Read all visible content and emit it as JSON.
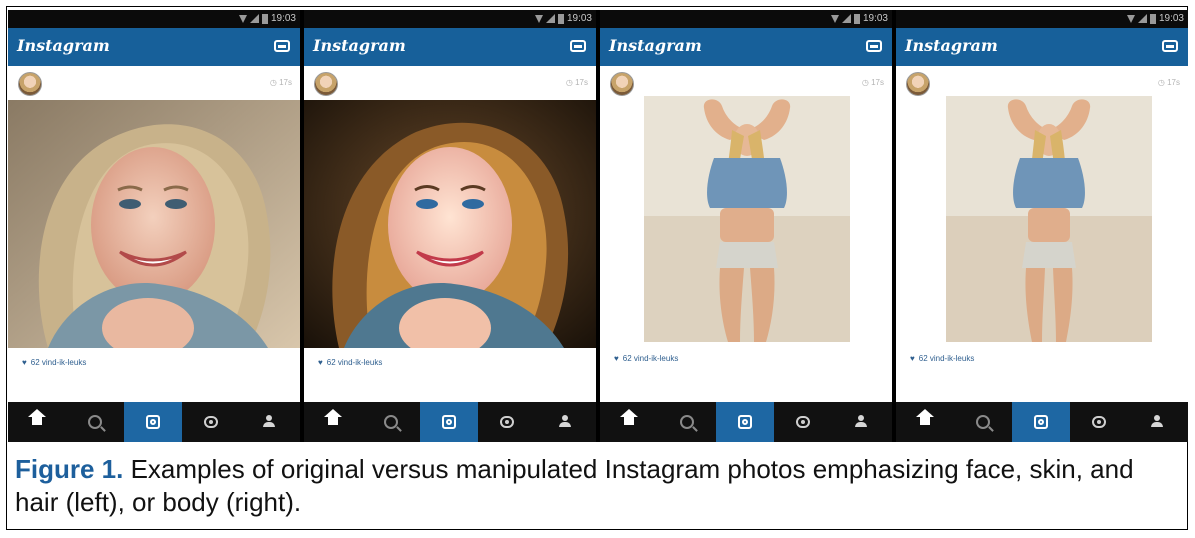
{
  "screens": [
    {
      "statusbar_time": "19:03",
      "brand": "Instagram",
      "timestamp": "17s",
      "likes": "62 vind-ik-leuks",
      "photo": "selfie-original",
      "active_tab": "camera"
    },
    {
      "statusbar_time": "19:03",
      "brand": "Instagram",
      "timestamp": "17s",
      "likes": "62 vind-ik-leuks",
      "photo": "selfie-manipulated",
      "active_tab": "camera"
    },
    {
      "statusbar_time": "19:03",
      "brand": "Instagram",
      "timestamp": "17s",
      "likes": "62 vind-ik-leuks",
      "photo": "body-original",
      "active_tab": "camera"
    },
    {
      "statusbar_time": "19:03",
      "brand": "Instagram",
      "timestamp": "17s",
      "likes": "62 vind-ik-leuks",
      "photo": "body-manipulated",
      "active_tab": "camera"
    }
  ],
  "tabs": [
    "home-icon",
    "search-icon",
    "camera-icon",
    "news-icon",
    "profile-icon"
  ],
  "caption": {
    "label": "Figure 1.",
    "text": " Examples of original versus manipulated Instagram photos emphasizing face, skin, and hair (left), or body (right)."
  },
  "colors": {
    "appbar": "#17609a",
    "tabbar": "#111111",
    "active_tab": "#1e67a3",
    "caption_label": "#1d5f9c"
  }
}
